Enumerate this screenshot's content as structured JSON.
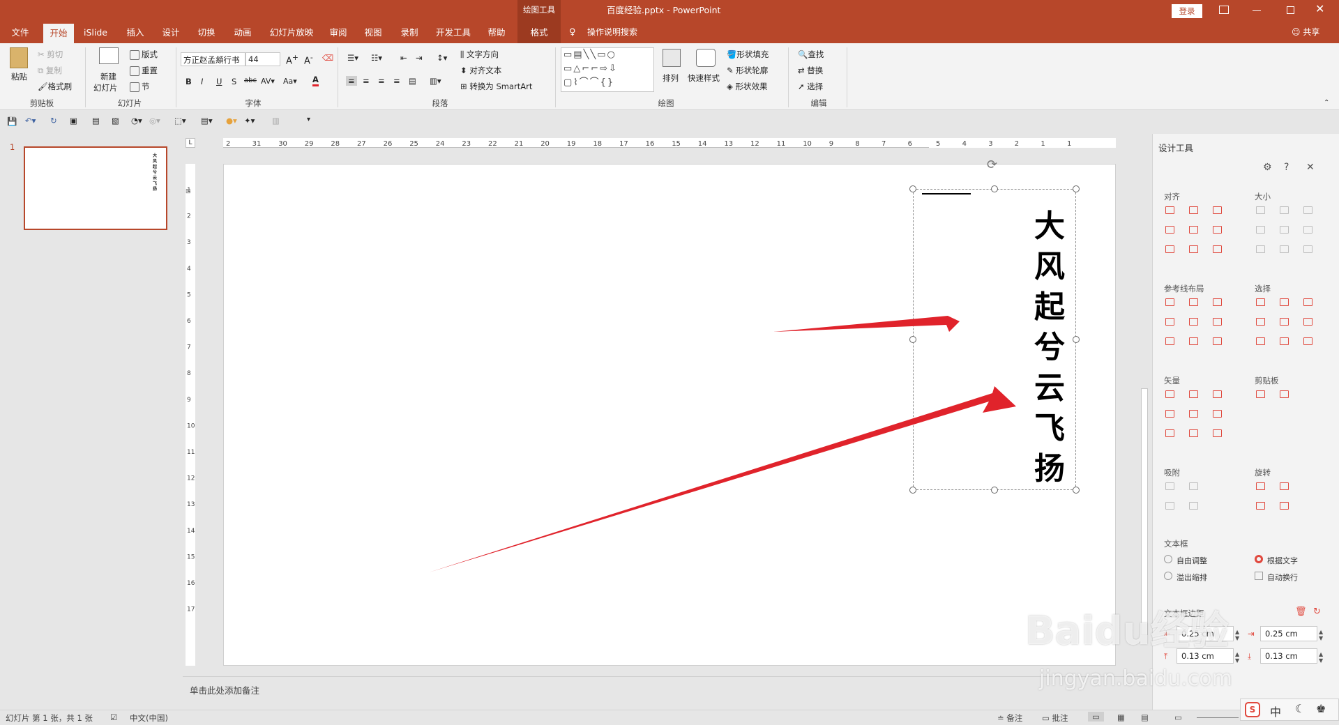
{
  "titlebar": {
    "context_tool": "绘图工具",
    "doc_title": "百度经验.pptx - PowerPoint",
    "login": "登录"
  },
  "tabs": [
    "文件",
    "开始",
    "iSlide",
    "插入",
    "设计",
    "切换",
    "动画",
    "幻灯片放映",
    "审阅",
    "视图",
    "录制",
    "开发工具",
    "帮助",
    "格式"
  ],
  "active_tab": "开始",
  "tell_me": "操作说明搜索",
  "share": "共享",
  "ribbon": {
    "clipboard": {
      "paste": "粘贴",
      "cut": "剪切",
      "copy": "复制",
      "format_painter": "格式刷",
      "label": "剪贴板"
    },
    "slides": {
      "new_slide_1": "新建",
      "new_slide_2": "幻灯片",
      "layout": "版式",
      "reset": "重置",
      "section": "节",
      "label": "幻灯片"
    },
    "font": {
      "name": "方正赵孟頫行书",
      "size": "44",
      "label": "字体"
    },
    "paragraph": {
      "text_direction": "文字方向",
      "align_text": "对齐文本",
      "convert_smartart": "转换为 SmartArt",
      "label": "段落"
    },
    "drawing": {
      "arrange": "排列",
      "quick_styles": "快速样式",
      "shape_fill": "形状填充",
      "shape_outline": "形状轮廓",
      "shape_effects": "形状效果",
      "label": "绘图"
    },
    "editing": {
      "find": "查找",
      "replace": "替换",
      "select": "选择",
      "label": "编辑"
    }
  },
  "slide_panel": {
    "number": "1"
  },
  "slide_text": [
    "大",
    "风",
    "起",
    "兮",
    "云",
    "飞",
    "扬"
  ],
  "ruler": {
    "h_left": [
      "2",
      "31",
      "30",
      "29",
      "28",
      "27",
      "26",
      "25",
      "24",
      "23",
      "22",
      "21",
      "20",
      "19",
      "18",
      "17",
      "16",
      "15",
      "14",
      "13",
      "12",
      "11",
      "10",
      "9",
      "8",
      "7",
      "6"
    ],
    "h_right": [
      "5",
      "4",
      "3",
      "2",
      "1",
      "1"
    ],
    "v": [
      "1",
      "2",
      "3",
      "4",
      "5",
      "6",
      "7",
      "8",
      "9",
      "10",
      "11",
      "12",
      "13",
      "14",
      "15",
      "16",
      "17"
    ]
  },
  "notes_placeholder": "单击此处添加备注",
  "design_pane": {
    "title": "设计工具",
    "sections": {
      "align": "对齐",
      "size": "大小",
      "guides": "参考线布局",
      "select": "选择",
      "vector": "矢量",
      "clipboard": "剪贴板",
      "snap": "吸附",
      "rotate": "旋转",
      "textbox": "文本框",
      "margins": "文本框边距"
    },
    "textbox_options": {
      "free_resize": "自由调整",
      "fit_text": "根据文字",
      "overflow_shrink": "溢出缩排",
      "auto_wrap": "自动换行"
    },
    "margins": {
      "left": "0.25 cm",
      "right": "0.25 cm",
      "top": "0.13 cm",
      "bottom": "0.13 cm"
    }
  },
  "status": {
    "slide_info": "幻灯片 第 1 张，共 1 张",
    "language": "中文(中国)",
    "notes": "备注",
    "comments": "批注"
  },
  "ime": {
    "lang": "中"
  },
  "watermark": {
    "brand": "Baidu经验",
    "url": "jingyan.baidu.com"
  },
  "colors": {
    "accent": "#b7472a",
    "arrow": "#e0232b"
  }
}
